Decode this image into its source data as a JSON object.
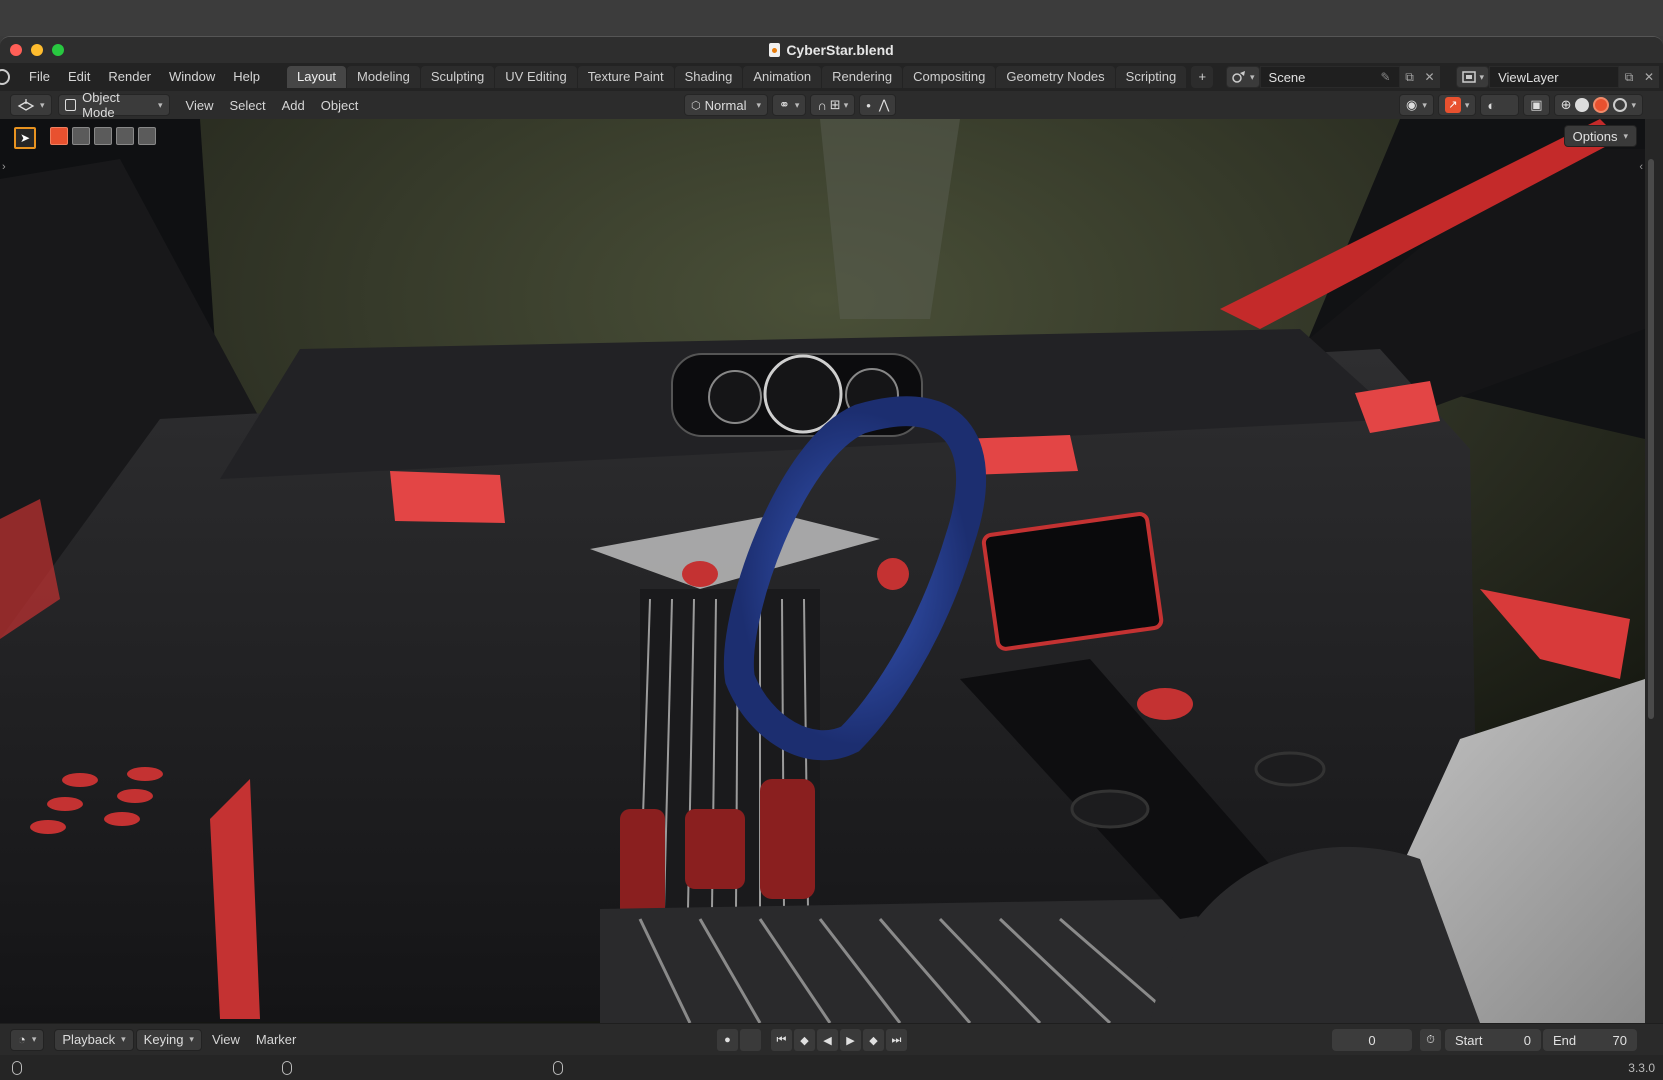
{
  "window": {
    "title": "CyberStar.blend",
    "file_icon": "blend-file-icon"
  },
  "menu": {
    "items": [
      "File",
      "Edit",
      "Render",
      "Window",
      "Help"
    ]
  },
  "workspaces": {
    "tabs": [
      "Layout",
      "Modeling",
      "Sculpting",
      "UV Editing",
      "Texture Paint",
      "Shading",
      "Animation",
      "Rendering",
      "Compositing",
      "Geometry Nodes",
      "Scripting"
    ],
    "active": "Layout",
    "add_label": "+"
  },
  "scene": {
    "name": "Scene",
    "view_layer": "ViewLayer"
  },
  "viewport_header": {
    "mode": "Object Mode",
    "menus": [
      "View",
      "Select",
      "Add",
      "Object"
    ],
    "orientation": "Normal"
  },
  "viewport": {
    "options_label": "Options"
  },
  "timeline": {
    "playback": "Playback",
    "keying": "Keying",
    "view": "View",
    "marker": "Marker",
    "current_frame": "0",
    "start_label": "Start",
    "start_value": "0",
    "end_label": "End",
    "end_value": "70"
  },
  "status": {
    "version": "3.3.0"
  },
  "colors": {
    "accent_orange": "#e89320",
    "active_red": "#e8512f",
    "header_bg": "#2c2c2c"
  }
}
